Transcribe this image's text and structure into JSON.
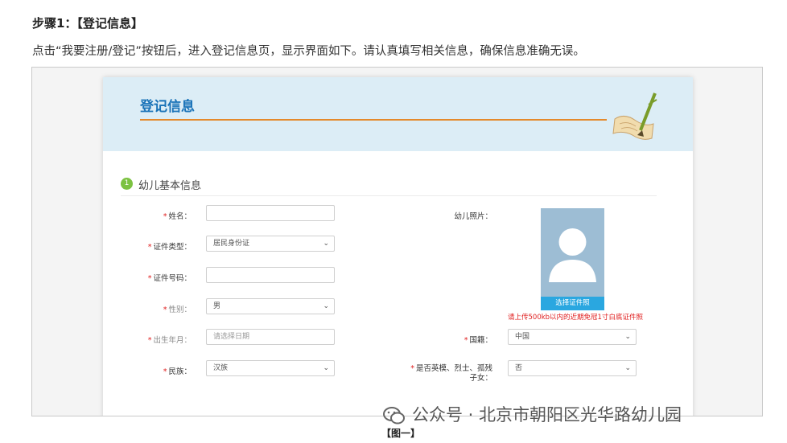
{
  "doc": {
    "step_title": "步骤1：【登记信息】",
    "intro": "点击“我要注册/登记”按钮后，进入登记信息页，显示界面如下。请认真填写相关信息，确保信息准确无误。",
    "caption": "【图一】",
    "watermark": "公众号 · 北京市朝阳区光华路幼儿园"
  },
  "form": {
    "title": "登记信息",
    "section_number": "1",
    "section_title": "幼儿基本信息",
    "required_mark": "*",
    "name_label": "姓名：",
    "id_type_label": "证件类型：",
    "id_type_value": "居民身份证",
    "id_number_label": "证件号码：",
    "gender_label": "性别：",
    "gender_value": "男",
    "birth_label": "出生年月：",
    "birth_placeholder": "请选择日期",
    "ethnicity_label": "民族：",
    "ethnicity_value": "汉族",
    "photo_label": "幼儿照片：",
    "photo_button": "选择证件照",
    "photo_hint": "请上传500kb以内的近期免冠1寸白底证件照",
    "nationality_label": "国籍：",
    "nationality_value": "中国",
    "hero_label": "是否英模、烈士、孤残子女：",
    "hero_value": "否"
  },
  "colors": {
    "title_blue": "#1a73b8",
    "rule_orange": "#e4892b",
    "header_bg": "#dcedf6",
    "required_red": "#e02020",
    "section_green": "#7cc241",
    "photo_button_blue": "#2aa7e0"
  }
}
